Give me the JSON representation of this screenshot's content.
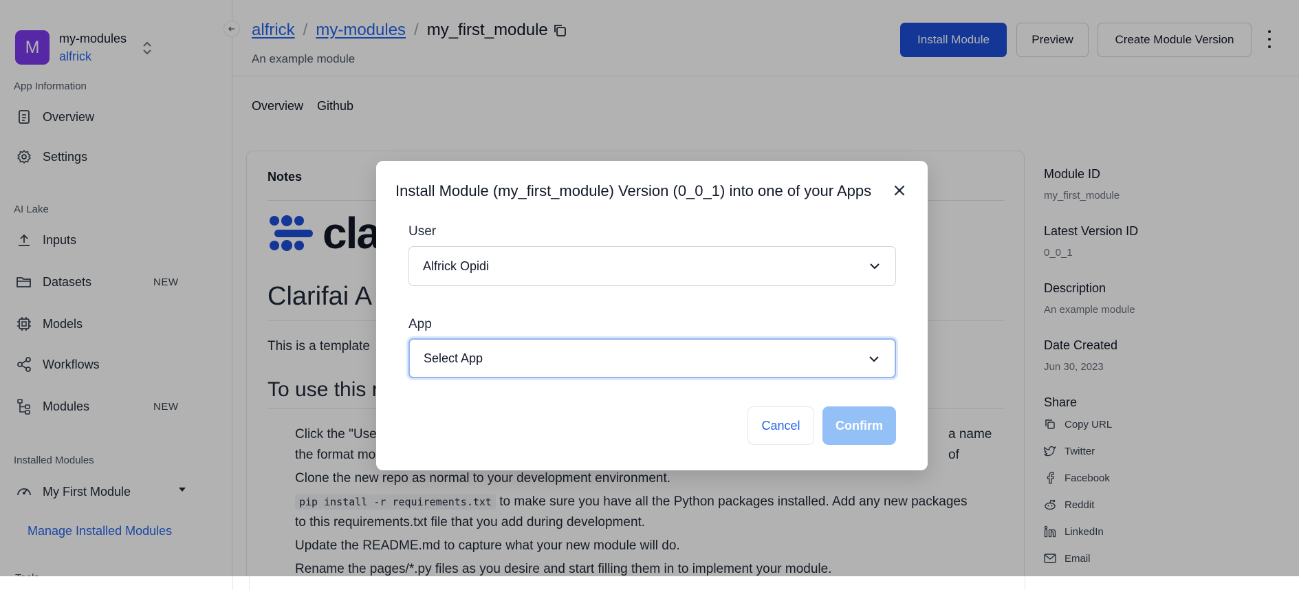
{
  "sidebar": {
    "app_initial": "M",
    "app_name": "my-modules",
    "app_owner": "alfrick",
    "sections": {
      "app_information": "App Information",
      "ai_lake": "AI Lake",
      "installed_modules": "Installed Modules"
    },
    "items": [
      {
        "label": "Overview",
        "icon": "document-icon"
      },
      {
        "label": "Settings",
        "icon": "gear-icon"
      },
      {
        "label": "Inputs",
        "icon": "upload-icon"
      },
      {
        "label": "Datasets",
        "icon": "folder-icon",
        "badge": "NEW"
      },
      {
        "label": "Models",
        "icon": "chip-icon"
      },
      {
        "label": "Workflows",
        "icon": "share-nodes-icon"
      },
      {
        "label": "Modules",
        "icon": "tree-icon",
        "badge": "NEW"
      }
    ],
    "installed_module": "My First Module",
    "manage_link": "Manage Installed Modules",
    "cut_off_label": "Tools"
  },
  "header": {
    "breadcrumb": {
      "owner": "alfrick",
      "app": "my-modules",
      "current": "my_first_module"
    },
    "subtitle": "An example module",
    "install_button": "Install Module",
    "preview_button": "Preview",
    "create_version_button": "Create Module Version"
  },
  "tabs": [
    "Overview",
    "Github"
  ],
  "notes": {
    "title": "Notes",
    "logo_text": "cla",
    "heading": "Clarifai A",
    "intro": "This is a template",
    "use_heading": "To use this r",
    "steps": {
      "s1_start": "Click the \"Use",
      "s1_end": "a name of",
      "s1_line2": "the format mo",
      "s2": "Clone the new repo as normal to your development environment.",
      "s3_code": "pip install -r requirements.txt",
      "s3_text": " to make sure you have all the Python packages installed. Add any new packages",
      "s3_line2": "to this requirements.txt file that you add during development.",
      "s4": "Update the README.md to capture what your new module will do.",
      "s5": "Rename the pages/*.py files as you desire and start filling them in to implement your module."
    }
  },
  "meta": {
    "module_id_label": "Module ID",
    "module_id": "my_first_module",
    "latest_version_label": "Latest Version ID",
    "latest_version": "0_0_1",
    "description_label": "Description",
    "description": "An example module",
    "date_label": "Date Created",
    "date": "Jun 30, 2023",
    "share_label": "Share",
    "share": [
      "Copy URL",
      "Twitter",
      "Facebook",
      "Reddit",
      "LinkedIn",
      "Email"
    ]
  },
  "modal": {
    "title": "Install Module (my_first_module) Version (0_0_1) into one of your Apps",
    "user_label": "User",
    "user_value": "Alfrick Opidi",
    "app_label": "App",
    "app_placeholder": "Select App",
    "cancel": "Cancel",
    "confirm": "Confirm"
  },
  "colors": {
    "accent": "#1d4ed8",
    "link": "#2563eb",
    "avatar": "#7c3aed",
    "confirm_disabled": "#93c0f7"
  }
}
